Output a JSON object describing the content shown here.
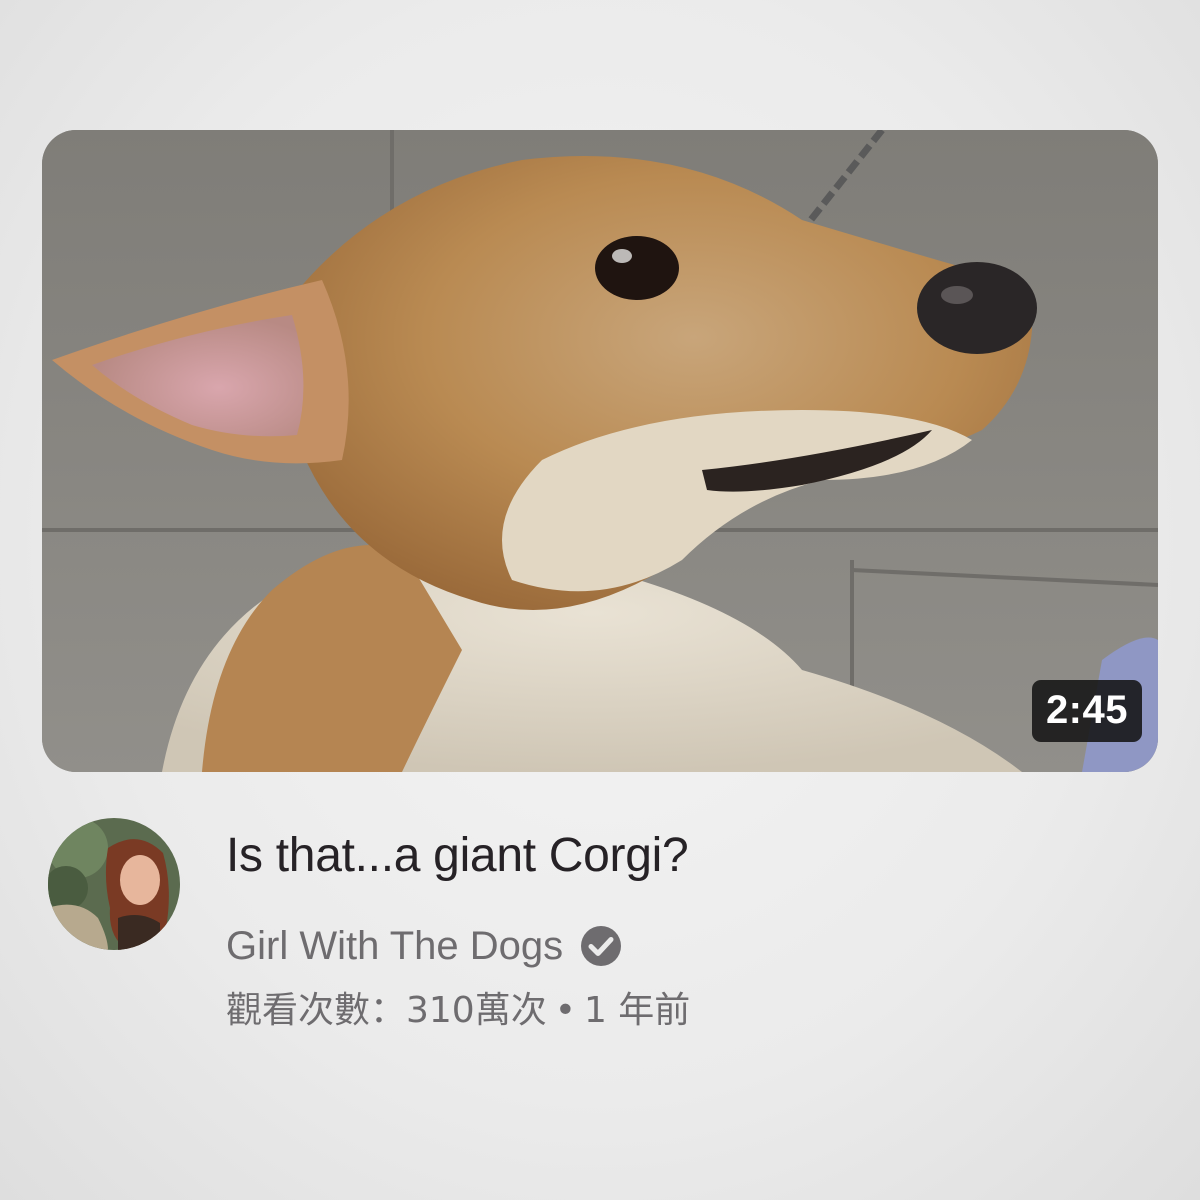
{
  "video": {
    "title": "Is that...a giant Corgi?",
    "duration": "2:45",
    "thumbnail_icon": "corgi-thumbnail",
    "channel": {
      "name": "Girl With The Dogs",
      "verified_icon": "verified-check-icon",
      "avatar_icon": "channel-avatar"
    },
    "views": "觀看次數：310萬次",
    "separator": "•",
    "published": "1 年前"
  },
  "colors": {
    "title": "#262226",
    "secondary_text": "#6e6c6f",
    "badge_background": "#141414",
    "badge_text": "#ffffff"
  }
}
